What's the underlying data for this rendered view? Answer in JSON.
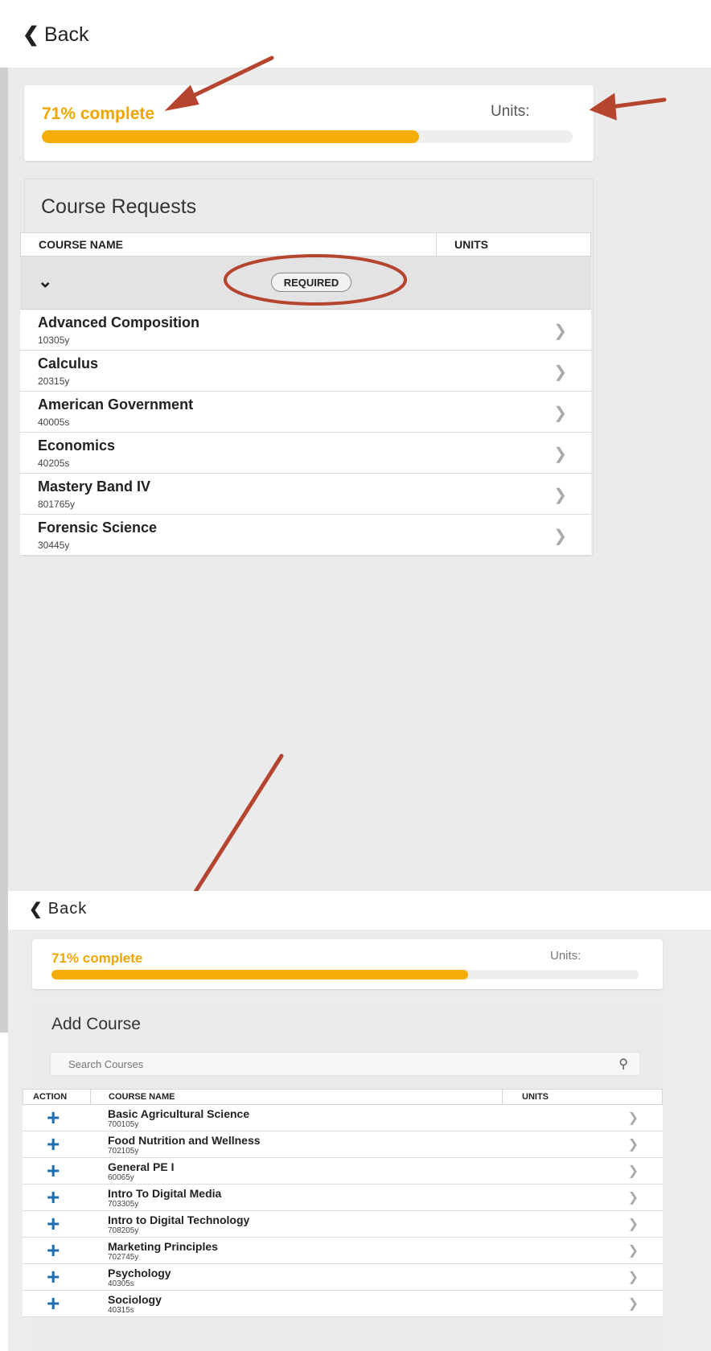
{
  "top_view": {
    "back_label": "Back",
    "progress": {
      "label": "71% complete",
      "percent": 71,
      "units_label": "Units:"
    },
    "card_title": "Course Requests",
    "columns": {
      "name": "COURSE NAME",
      "units": "UNITS"
    },
    "group_badge": "REQUIRED",
    "courses": [
      {
        "name": "Advanced Composition",
        "code": "10305y"
      },
      {
        "name": "Calculus",
        "code": "20315y"
      },
      {
        "name": "American Government",
        "code": "40005s"
      },
      {
        "name": "Economics",
        "code": "40205s"
      },
      {
        "name": "Mastery Band IV",
        "code": "801765y"
      },
      {
        "name": "Forensic Science",
        "code": "30445y"
      }
    ]
  },
  "bottom_view": {
    "back_label": "Back",
    "progress": {
      "label": "71% complete",
      "percent": 71,
      "units_label": "Units:"
    },
    "card_title": "Add Course",
    "search_placeholder": "Search Courses",
    "columns": {
      "action": "ACTION",
      "name": "COURSE NAME",
      "units": "UNITS"
    },
    "courses": [
      {
        "name": "Basic Agricultural Science",
        "code": "700105y"
      },
      {
        "name": "Food Nutrition and Wellness",
        "code": "702105y"
      },
      {
        "name": "General PE I",
        "code": "60065y"
      },
      {
        "name": "Intro To Digital Media",
        "code": "703305y"
      },
      {
        "name": "Intro to Digital Technology",
        "code": "708205y"
      },
      {
        "name": "Marketing Principles",
        "code": "702745y"
      },
      {
        "name": "Psychology",
        "code": "40305s"
      },
      {
        "name": "Sociology",
        "code": "40315s"
      }
    ]
  },
  "icons": {
    "back": "chevron-left-icon",
    "toggle": "chevron-down-icon",
    "row": "chevron-right-icon",
    "add": "plus-icon",
    "search": "search-icon"
  },
  "colors": {
    "progress_accent": "#f5ad0a",
    "progress_text": "#f0a500",
    "annotation": "#b5452f",
    "add_icon": "#1f6fb3"
  }
}
